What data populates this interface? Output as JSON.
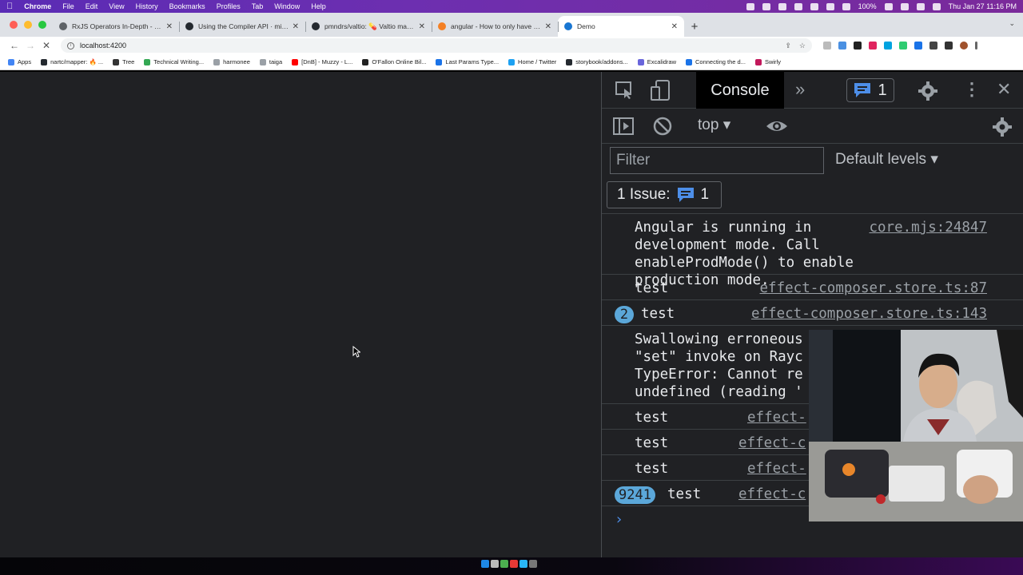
{
  "menubar": {
    "app": "Chrome",
    "items": [
      "File",
      "Edit",
      "View",
      "History",
      "Bookmarks",
      "Profiles",
      "Tab",
      "Window",
      "Help"
    ],
    "battery": "100%",
    "datetime": "Thu Jan 27  11:16 PM"
  },
  "tabs": [
    {
      "label": "RxJS Operators In-Depth - Par",
      "color": "#5f6368"
    },
    {
      "label": "Using the Compiler API · micro",
      "color": "#24292f"
    },
    {
      "label": "pmndrs/valtio: 💊 Valtio makes",
      "color": "#24292f"
    },
    {
      "label": "angular - How to only have sec",
      "color": "#f48024"
    },
    {
      "label": "Demo",
      "color": "#1976d2"
    }
  ],
  "toolbar": {
    "url": "localhost:4200"
  },
  "bookmarks": [
    {
      "label": "Apps",
      "color": "#4285f4"
    },
    {
      "label": "nartc/mapper: 🔥 ...",
      "color": "#24292f"
    },
    {
      "label": "Tree",
      "color": "#333333"
    },
    {
      "label": "Technical Writing...",
      "color": "#34a853"
    },
    {
      "label": "harmonee",
      "color": "#9aa0a6"
    },
    {
      "label": "taiga",
      "color": "#9aa0a6"
    },
    {
      "label": "[DnB] - Muzzy - L...",
      "color": "#ff0000"
    },
    {
      "label": "O'Fallon Online Bil...",
      "color": "#222222"
    },
    {
      "label": "Last Params Type...",
      "color": "#1a73e8"
    },
    {
      "label": "Home / Twitter",
      "color": "#1da1f2"
    },
    {
      "label": "storybook/addons...",
      "color": "#24292f"
    },
    {
      "label": "Excalidraw",
      "color": "#6965db"
    },
    {
      "label": "Connecting the d...",
      "color": "#1a73e8"
    },
    {
      "label": "Swirly",
      "color": "#c2185b"
    }
  ],
  "devtools": {
    "active_tab": "Console",
    "issues_badge": "1",
    "context": "top",
    "filter_placeholder": "Filter",
    "levels": "Default levels",
    "issues_summary": "1 Issue:",
    "issues_summary_count": "1",
    "messages": [
      {
        "text": "Angular is running in development mode. Call enableProdMode() to enable production mode.",
        "source": "core.mjs:24847"
      },
      {
        "text": "test",
        "source": "effect-composer.store.ts:87"
      },
      {
        "count": "2",
        "text": "test",
        "source": "effect-composer.store.ts:143"
      },
      {
        "text": "Swallowing erroneous \"set\" invoke on Rayc TypeError: Cannot re undefined (reading '",
        "source": ""
      },
      {
        "text": "test",
        "source": "effect-"
      },
      {
        "text": "test",
        "source": "effect-c"
      },
      {
        "text": "test",
        "source": "effect-"
      },
      {
        "count": "9241",
        "text": "test",
        "source": "effect-c"
      }
    ]
  }
}
